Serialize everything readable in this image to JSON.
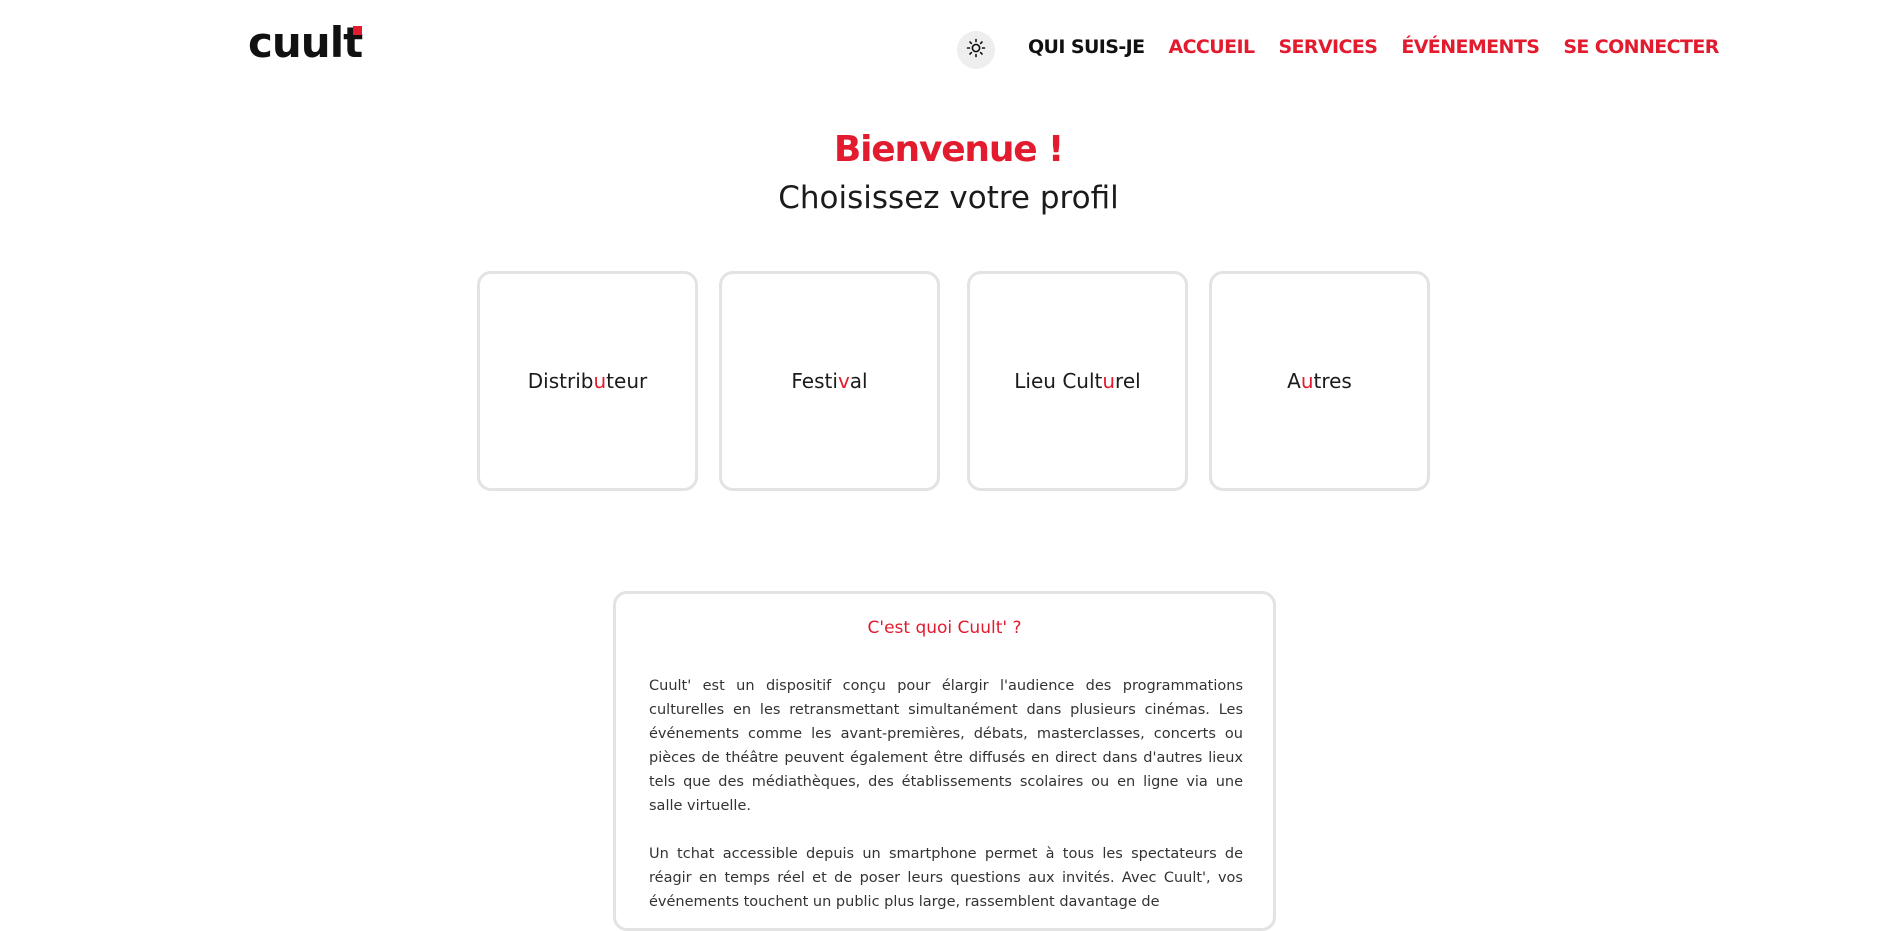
{
  "brand": {
    "logo_text": "cuult",
    "accent_color": "#e21b2f"
  },
  "header": {
    "theme_toggle_icon": "sun-icon",
    "nav": {
      "about_label": "QUI SUIS-JE",
      "home_label": "ACCUEIL",
      "services_label": "SERVICES",
      "events_label": "ÉVÉNEMENTS",
      "login_label": "SE CONNECTER"
    }
  },
  "hero": {
    "title": "Bienvenue !",
    "subtitle": "Choisissez votre profil"
  },
  "profiles": [
    {
      "label": "Distributeur",
      "before": "Distrib",
      "highlight": "u",
      "after": "teur"
    },
    {
      "label": "Festival",
      "before": "Festi",
      "highlight": "v",
      "after": "al"
    },
    {
      "label": "Lieu Culturel",
      "before": "Lieu Cult",
      "highlight": "u",
      "after": "rel"
    },
    {
      "label": "Autres",
      "before": "A",
      "highlight": "u",
      "after": "tres"
    }
  ],
  "about": {
    "title": "C'est quoi Cuult' ?",
    "paragraph_1": "Cuult' est un dispositif conçu pour élargir l'audience des programmations culturelles en les retransmettant simultanément dans plusieurs cinémas. Les événements comme les avant-premières, débats, masterclasses, concerts ou pièces de théâtre peuvent également être diffusés en direct dans d'autres lieux tels que des médiathèques, des établissements scolaires ou en ligne via une salle virtuelle.",
    "paragraph_2": "Un tchat accessible depuis un smartphone permet à tous les spectateurs de réagir en temps réel et de poser leurs questions aux invités. Avec Cuult', vos événements touchent un public plus large, rassemblent davantage de"
  }
}
